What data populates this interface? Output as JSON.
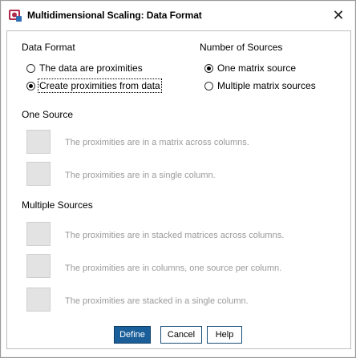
{
  "window": {
    "title": "Multidimensional Scaling: Data Format"
  },
  "data_format": {
    "header": "Data Format",
    "option1": "The data are proximities",
    "option2": "Create proximities from data",
    "selected": "option2"
  },
  "number_of_sources": {
    "header": "Number of Sources",
    "option1": "One matrix source",
    "option2": "Multiple matrix sources",
    "selected": "option1"
  },
  "one_source": {
    "header": "One Source",
    "item1": "The proximities are in a matrix across columns.",
    "item2": "The proximities are in a single column."
  },
  "multiple_sources": {
    "header": "Multiple Sources",
    "item1": "The proximities are in stacked matrices across columns.",
    "item2": "The proximities are in columns, one source per column.",
    "item3": "The proximities are stacked in a single column."
  },
  "buttons": {
    "define": "Define",
    "cancel": "Cancel",
    "help": "Help"
  }
}
